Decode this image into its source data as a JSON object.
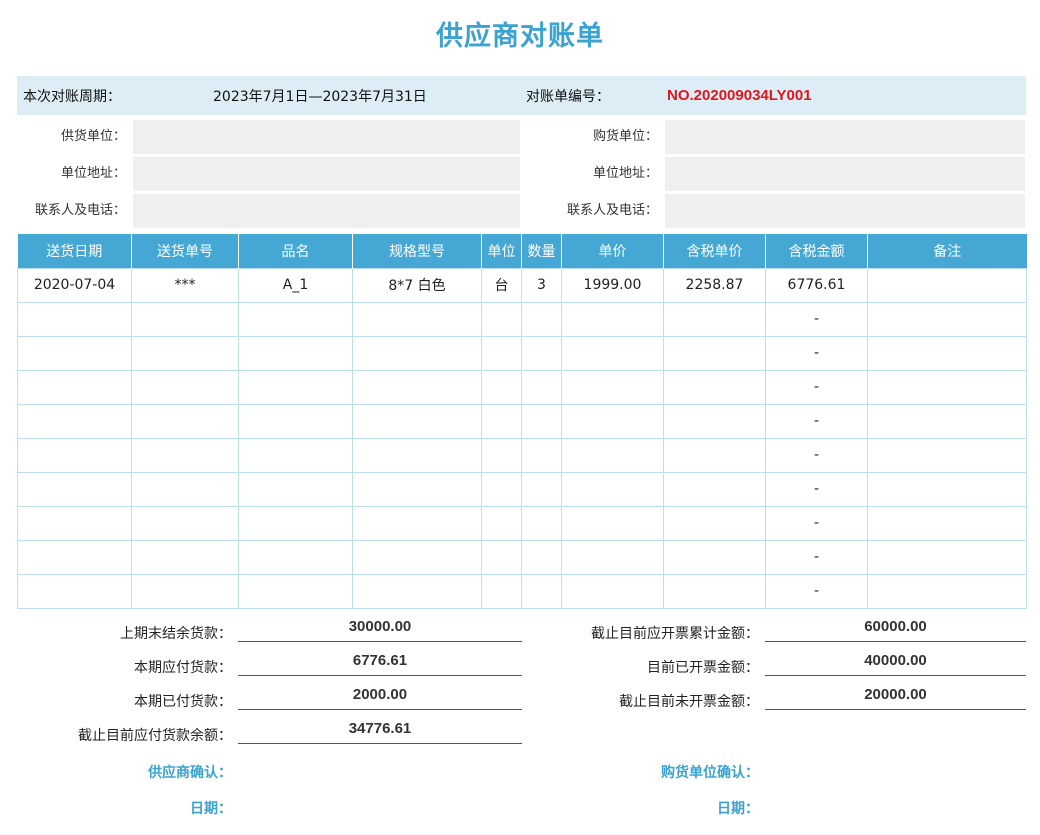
{
  "title": "供应商对账单",
  "period": {
    "label": "本次对账周期：",
    "value": "2023年7月1日—2023年7月31日",
    "number_label": "对账单编号：",
    "number_value": "NO.202009034LY001",
    "number_color": "#e0151c"
  },
  "supplier": {
    "unit_label": "供货单位：",
    "address_label": "单位地址：",
    "contact_label": "联系人及电话："
  },
  "buyer": {
    "unit_label": "购货单位：",
    "address_label": "单位地址：",
    "contact_label": "联系人及电话："
  },
  "table": {
    "headers": [
      "送货日期",
      "送货单号",
      "品名",
      "规格型号",
      "单位",
      "数量",
      "单价",
      "含税单价",
      "含税金额",
      "备注"
    ],
    "rows": [
      [
        "2020-07-04",
        "***",
        "A_1",
        "8*7 白色",
        "台",
        "3",
        "1999.00",
        "2258.87",
        "6776.61",
        ""
      ],
      [
        "",
        "",
        "",
        "",
        "",
        "",
        "",
        "",
        "-",
        ""
      ],
      [
        "",
        "",
        "",
        "",
        "",
        "",
        "",
        "",
        "-",
        ""
      ],
      [
        "",
        "",
        "",
        "",
        "",
        "",
        "",
        "",
        "-",
        ""
      ],
      [
        "",
        "",
        "",
        "",
        "",
        "",
        "",
        "",
        "-",
        ""
      ],
      [
        "",
        "",
        "",
        "",
        "",
        "",
        "",
        "",
        "-",
        ""
      ],
      [
        "",
        "",
        "",
        "",
        "",
        "",
        "",
        "",
        "-",
        ""
      ],
      [
        "",
        "",
        "",
        "",
        "",
        "",
        "",
        "",
        "-",
        ""
      ],
      [
        "",
        "",
        "",
        "",
        "",
        "",
        "",
        "",
        "-",
        ""
      ],
      [
        "",
        "",
        "",
        "",
        "",
        "",
        "",
        "",
        "-",
        ""
      ]
    ],
    "header_color": "#45a8d4"
  },
  "summary_left": [
    {
      "label": "上期末结余货款：",
      "value": "30000.00"
    },
    {
      "label": "本期应付货款：",
      "value": "6776.61"
    },
    {
      "label": "本期已付货款：",
      "value": "2000.00"
    },
    {
      "label": "截止目前应付货款余额：",
      "value": "34776.61"
    }
  ],
  "summary_right": [
    {
      "label": "截止目前应开票累计金额：",
      "value": "60000.00"
    },
    {
      "label": "目前已开票金额：",
      "value": "40000.00"
    },
    {
      "label": "截止目前未开票金额：",
      "value": "20000.00"
    }
  ],
  "confirm": {
    "supplier_label": "供应商确认：",
    "buyer_label": "购货单位确认：",
    "date_label_left": "日期：",
    "date_label_right": "日期："
  },
  "accent_color": "#3aa3d1"
}
